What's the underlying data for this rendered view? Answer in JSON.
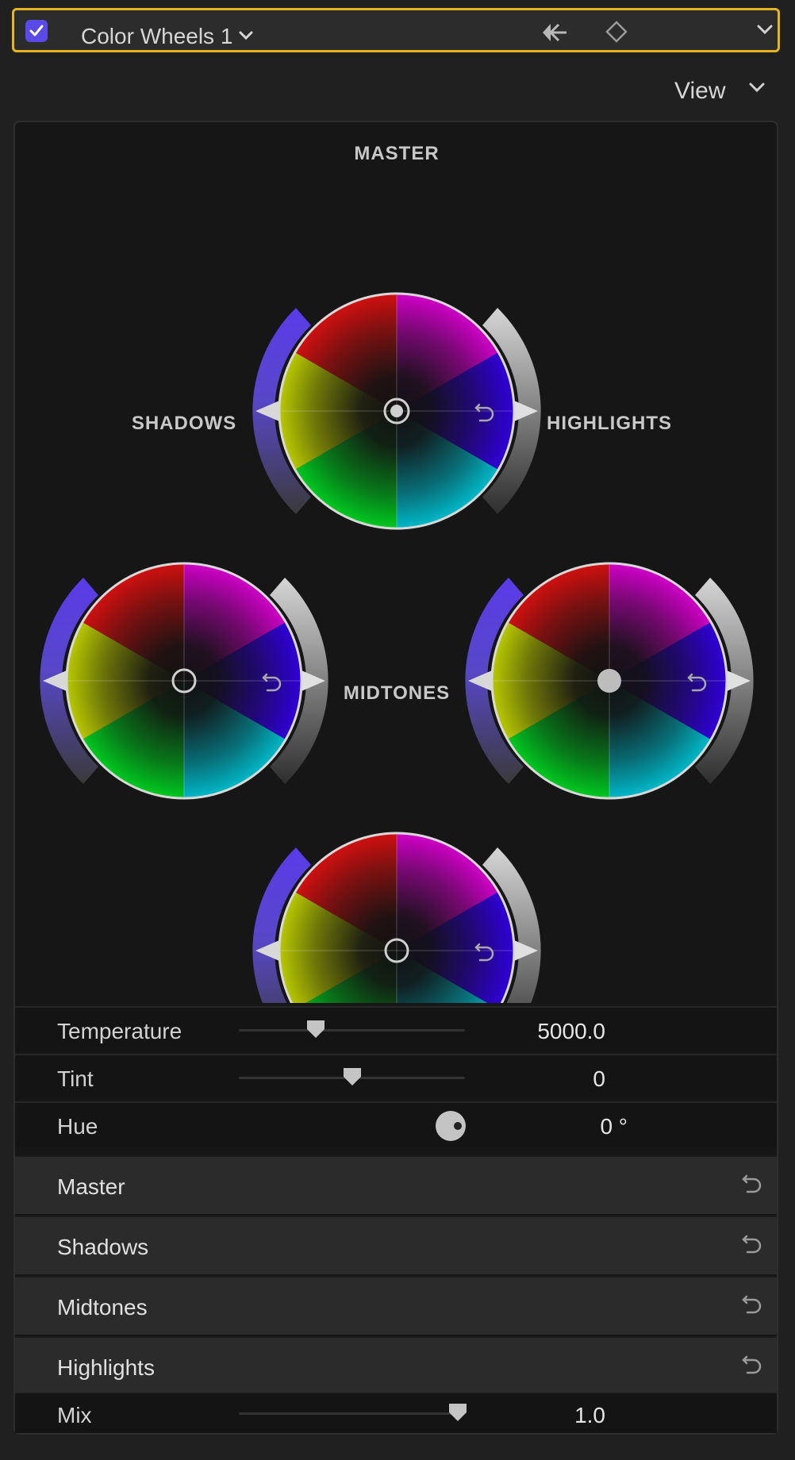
{
  "header": {
    "enabled": true,
    "effect_name": "Color Wheels 1",
    "icons": [
      "checkbox-checked",
      "chevron-down-icon",
      "keyframe-navigate-icon",
      "keyframe-diamond-icon",
      "chevron-down-icon"
    ]
  },
  "view_menu": {
    "label": "View"
  },
  "wheels": [
    {
      "id": "master",
      "label": "MASTER",
      "puck_style": "ringed"
    },
    {
      "id": "shadows",
      "label": "SHADOWS",
      "puck_style": "ring"
    },
    {
      "id": "highlights",
      "label": "HIGHLIGHTS",
      "puck_style": "filled"
    },
    {
      "id": "midtones",
      "label": "MIDTONES",
      "puck_style": "ring"
    }
  ],
  "params": {
    "temperature": {
      "label": "Temperature",
      "value": "5000.0",
      "slider_fraction": 0.34
    },
    "tint": {
      "label": "Tint",
      "value": "0",
      "slider_fraction": 0.5
    },
    "hue": {
      "label": "Hue",
      "value": "0 °"
    }
  },
  "groups": [
    {
      "label": "Master"
    },
    {
      "label": "Shadows"
    },
    {
      "label": "Midtones"
    },
    {
      "label": "Highlights"
    }
  ],
  "mix": {
    "label": "Mix",
    "value": "1.0",
    "slider_fraction": 0.97
  },
  "colors": {
    "accent_purple": "#5a4be8",
    "header_border": "#e6b321",
    "panel_bg": "#161616"
  }
}
